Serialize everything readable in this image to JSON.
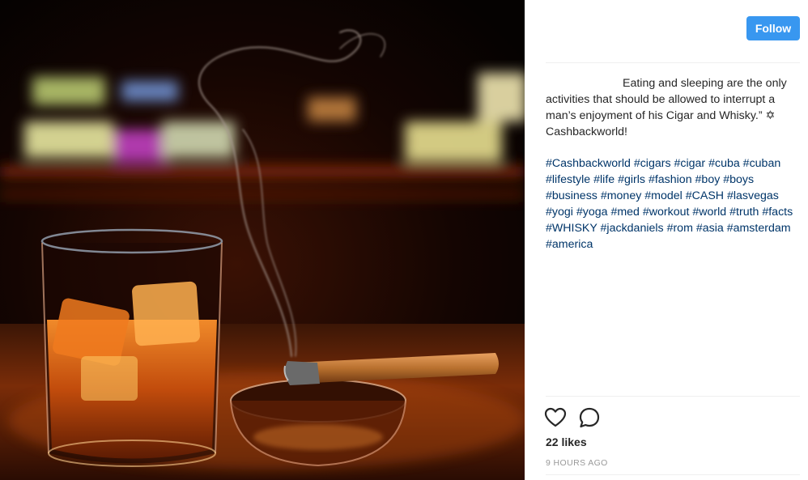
{
  "post": {
    "image": {
      "subject": "glass of whisky with ice and a lit cigar on an ashtray",
      "palette": {
        "background": "#050201",
        "amber": "#d8661a",
        "deep_amber": "#7a2a06",
        "highlight": "#ffcc66",
        "cigar": "#b8702e",
        "smoke": "#a89a92"
      }
    },
    "header": {
      "follow_label": "Follow",
      "follow_color": "#3897f0"
    },
    "caption": {
      "text": "Eating and sleeping are the only activities that should be allowed to interrupt a man’s enjoyment of his Cigar and Whisky.” ✡ Cashbackworld!",
      "hashtags": "#Cashbackworld #cigars #cigar #cuba #cuban #lifestyle #life #girls #fashion #boy #boys #business #money #model #CASH #lasvegas #yogi #yoga #med #workout #world #truth #facts #WHISKY #jackdaniels #rom #asia #amsterdam #america",
      "hashtag_color": "#003569"
    },
    "actions": {
      "like_icon": "heart-outline-icon",
      "comment_icon": "comment-bubble-icon"
    },
    "likes": "22 likes",
    "timestamp": "9 HOURS AGO"
  }
}
